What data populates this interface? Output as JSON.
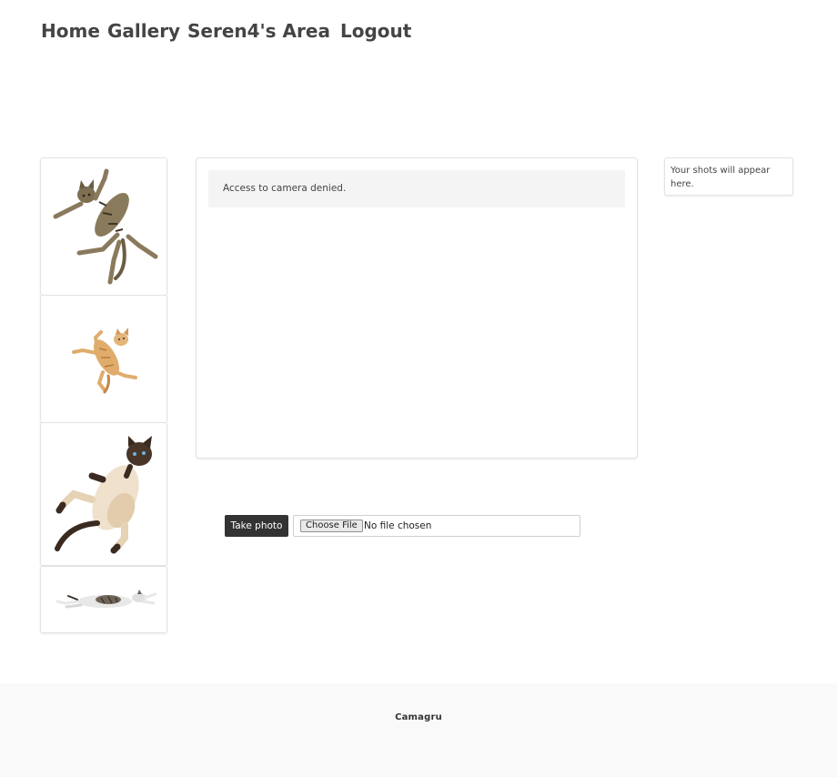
{
  "nav": {
    "home": "Home",
    "gallery": "Gallery",
    "user_area": "Seren4's Area",
    "logout": "Logout"
  },
  "stickers": [
    {
      "name": "tabby-cat-jumping",
      "colors": {
        "body": "#8a7a5c",
        "stripe": "#3f3526"
      }
    },
    {
      "name": "orange-cat-flying",
      "colors": {
        "body": "#e0ac6c",
        "stripe": "#b87a3a"
      }
    },
    {
      "name": "siamese-cat-falling",
      "colors": {
        "body": "#efe1cc",
        "point": "#3b2a20"
      }
    },
    {
      "name": "calico-cat-stretching",
      "colors": {
        "body": "#e8e8e8",
        "patch": "#6f6458"
      }
    }
  ],
  "camera": {
    "message": "Access to camera denied."
  },
  "shots": {
    "placeholder": "Your shots will appear here."
  },
  "controls": {
    "take_photo_label": "Take photo",
    "choose_file_label": "Choose File",
    "file_status": "No file chosen"
  },
  "footer": {
    "brand": "Camagru"
  },
  "colors": {
    "nav_text": "#444444",
    "button_bg": "#333333",
    "message_bg": "#f4f4f4",
    "footer_bg": "#f9f9f9"
  }
}
